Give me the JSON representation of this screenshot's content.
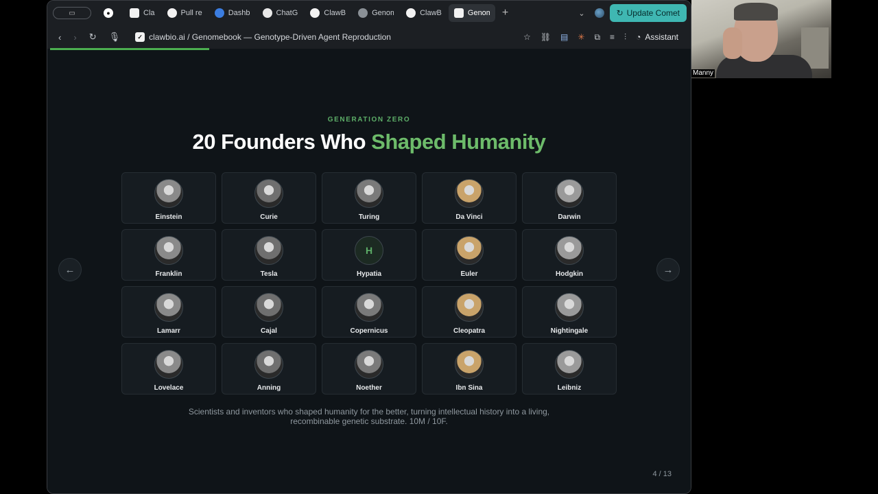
{
  "tabs": [
    {
      "label": "Cla",
      "icon": "clawbio-icon",
      "active": false
    },
    {
      "label": "Pull re",
      "icon": "github-icon",
      "active": false
    },
    {
      "label": "Dashb",
      "icon": "dashboard-icon",
      "active": false
    },
    {
      "label": "ChatG",
      "icon": "chatgpt-icon",
      "active": false
    },
    {
      "label": "ClawB",
      "icon": "github-icon",
      "active": false
    },
    {
      "label": "Genom",
      "icon": "globe-icon",
      "active": false
    },
    {
      "label": "ClawB",
      "icon": "github-icon",
      "active": false
    },
    {
      "label": "Genom",
      "icon": "clawbio-icon",
      "active": true
    }
  ],
  "update_button": "Update Comet",
  "address": "clawbio.ai / Genomebook — Genotype-Driven Agent Reproduction",
  "assistant_label": "Assistant",
  "slide": {
    "kicker": "GENERATION ZERO",
    "title_main": "20 Founders Who ",
    "title_accent": "Shaped Humanity",
    "caption_line1": "Scientists and inventors who shaped humanity for the better, turning intellectual history into a living,",
    "caption_line2": "recombinable genetic substrate. 10M / 10F.",
    "page_indicator": "4 / 13",
    "founders": [
      {
        "name": "Einstein",
        "initial": ""
      },
      {
        "name": "Curie",
        "initial": ""
      },
      {
        "name": "Turing",
        "initial": ""
      },
      {
        "name": "Da Vinci",
        "initial": ""
      },
      {
        "name": "Darwin",
        "initial": ""
      },
      {
        "name": "Franklin",
        "initial": ""
      },
      {
        "name": "Tesla",
        "initial": ""
      },
      {
        "name": "Hypatia",
        "initial": "H"
      },
      {
        "name": "Euler",
        "initial": ""
      },
      {
        "name": "Hodgkin",
        "initial": ""
      },
      {
        "name": "Lamarr",
        "initial": ""
      },
      {
        "name": "Cajal",
        "initial": ""
      },
      {
        "name": "Copernicus",
        "initial": ""
      },
      {
        "name": "Cleopatra",
        "initial": ""
      },
      {
        "name": "Nightingale",
        "initial": ""
      },
      {
        "name": "Lovelace",
        "initial": ""
      },
      {
        "name": "Anning",
        "initial": ""
      },
      {
        "name": "Noether",
        "initial": ""
      },
      {
        "name": "Ibn Sina",
        "initial": ""
      },
      {
        "name": "Leibniz",
        "initial": ""
      }
    ]
  },
  "colors": {
    "accent_green": "#6dbb6a",
    "update_button": "#3fb7b2",
    "slide_bg": "#0f1418"
  },
  "webcam": {
    "participant_name": "Manny"
  }
}
